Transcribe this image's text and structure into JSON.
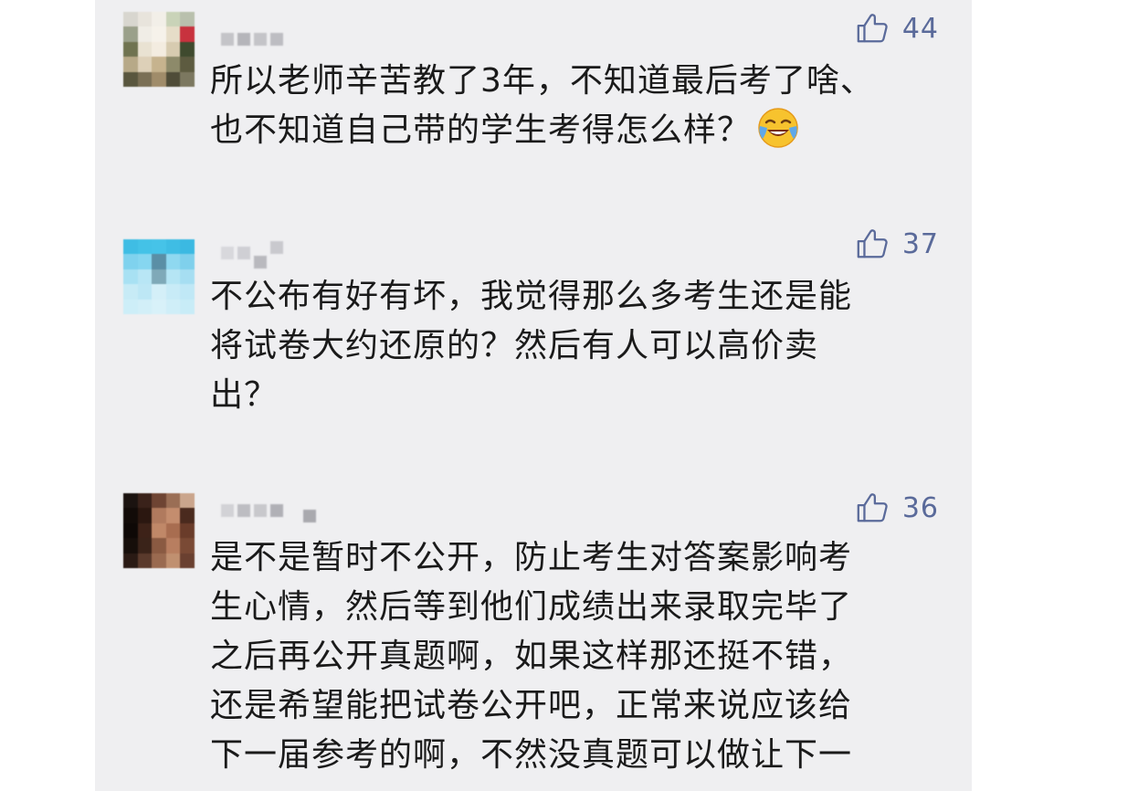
{
  "comments": [
    {
      "likes": "44",
      "text": "所以老师辛苦教了3年，不知道最后考了啥、\n也不知道自己带的学生考得怎么样？",
      "emoji": "face-with-tears-of-joy-icon"
    },
    {
      "likes": "37",
      "text": "不公布有好有坏，我觉得那么多考生还是能\n将试卷大约还原的？然后有人可以高价卖\n出？"
    },
    {
      "likes": "36",
      "text": "是不是暂时不公开，防止考生对答案影响考\n生心情，然后等到他们成绩出来录取完毕了\n之后再公开真题啊，如果这样那还挺不错，\n还是希望能把试卷公开吧，正常来说应该给\n下一届参考的啊，不然没真题可以做让下一"
    }
  ],
  "colors": {
    "panel_background": "#efeff1",
    "like_color": "#5a6a9a",
    "text_color": "#1a1a1a"
  }
}
